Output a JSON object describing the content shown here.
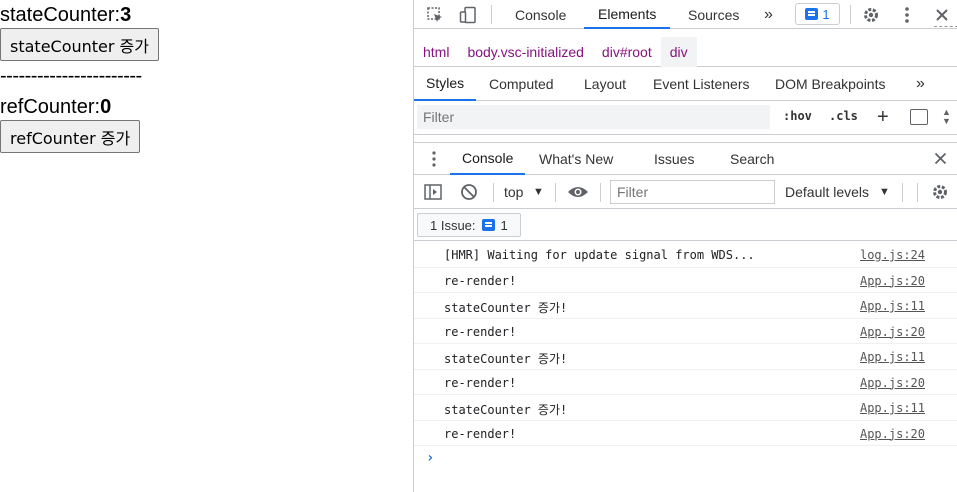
{
  "app": {
    "state_label": "stateCounter:",
    "state_value": "3",
    "state_button": "stateCounter 증가",
    "divider": "-----------------------",
    "ref_label": "refCounter:",
    "ref_value": "0",
    "ref_button": "refCounter 증가"
  },
  "devtools": {
    "main_tabs": [
      "Console",
      "Elements",
      "Sources"
    ],
    "active_main_tab": "Elements",
    "more_tabs": "»",
    "issues_badge_count": "1",
    "breadcrumbs": [
      "html",
      "body.vsc-initialized",
      "div#root",
      "div"
    ],
    "styles_tabs": [
      "Styles",
      "Computed",
      "Layout",
      "Event Listeners",
      "DOM Breakpoints"
    ],
    "styles_more": "»",
    "styles_filter_placeholder": "Filter",
    "hov": ":hov",
    "cls": ".cls",
    "drawer_tabs": [
      "Console",
      "What's New",
      "Issues",
      "Search"
    ],
    "console_context": "top",
    "console_filter_placeholder": "Filter",
    "log_level": "Default levels",
    "issues_label": "1 Issue:",
    "issues_count": "1",
    "logs": [
      {
        "msg": "[HMR] Waiting for update signal from WDS...",
        "src": "log.js:24"
      },
      {
        "msg": "re-render!",
        "src": "App.js:20"
      },
      {
        "msg": "stateCounter 증가!",
        "src": "App.js:11"
      },
      {
        "msg": "re-render!",
        "src": "App.js:20"
      },
      {
        "msg": "stateCounter 증가!",
        "src": "App.js:11"
      },
      {
        "msg": "re-render!",
        "src": "App.js:20"
      },
      {
        "msg": "stateCounter 증가!",
        "src": "App.js:11"
      },
      {
        "msg": "re-render!",
        "src": "App.js:20"
      }
    ],
    "prompt": "›",
    "icons": {
      "inspect": "inspect-element-icon",
      "device": "device-toggle-icon",
      "settings": "gear-icon",
      "menu": "kebab-menu-icon",
      "close": "close-icon"
    },
    "accent_color": "#1a73e8"
  }
}
